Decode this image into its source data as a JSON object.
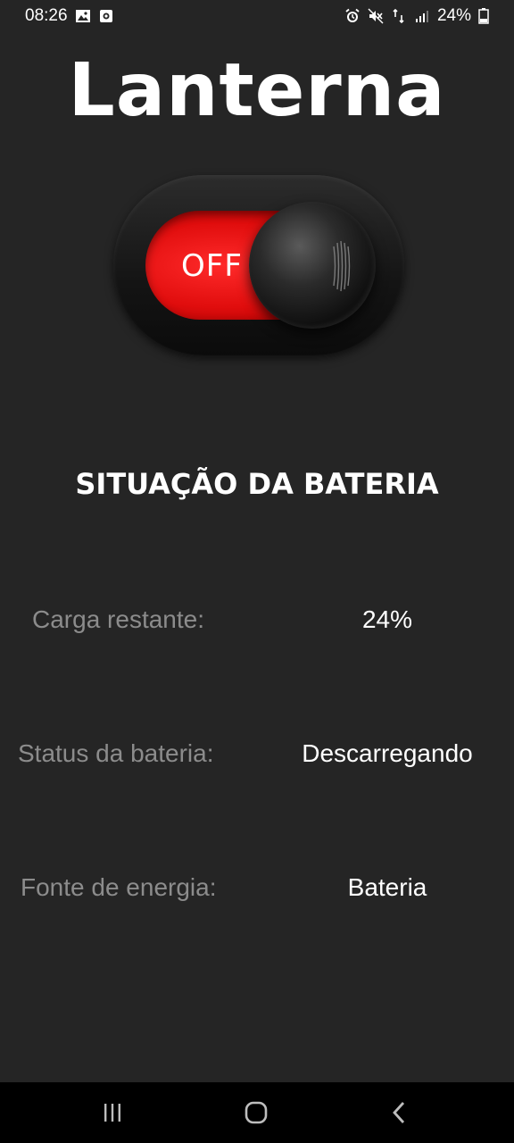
{
  "status_bar": {
    "time": "08:26",
    "battery_percent": "24%",
    "left_icons": [
      "gallery-icon",
      "screen-record-icon"
    ],
    "right_icons": [
      "alarm-icon",
      "mute-icon",
      "data-transfer-icon",
      "signal-icon",
      "battery-icon"
    ]
  },
  "app": {
    "title": "Lanterna"
  },
  "toggle": {
    "state_label": "OFF",
    "accent_color": "#e00d0d"
  },
  "battery_section": {
    "heading": "SITUAÇÃO DA BATERIA",
    "rows": [
      {
        "label": "Carga restante:",
        "value": "24%"
      },
      {
        "label": "Status da bateria:",
        "value": "Descarregando"
      },
      {
        "label": "Fonte de energia:",
        "value": "Bateria"
      }
    ]
  },
  "nav_bar": {
    "buttons": [
      "recent-apps-icon",
      "home-icon",
      "back-icon"
    ]
  }
}
